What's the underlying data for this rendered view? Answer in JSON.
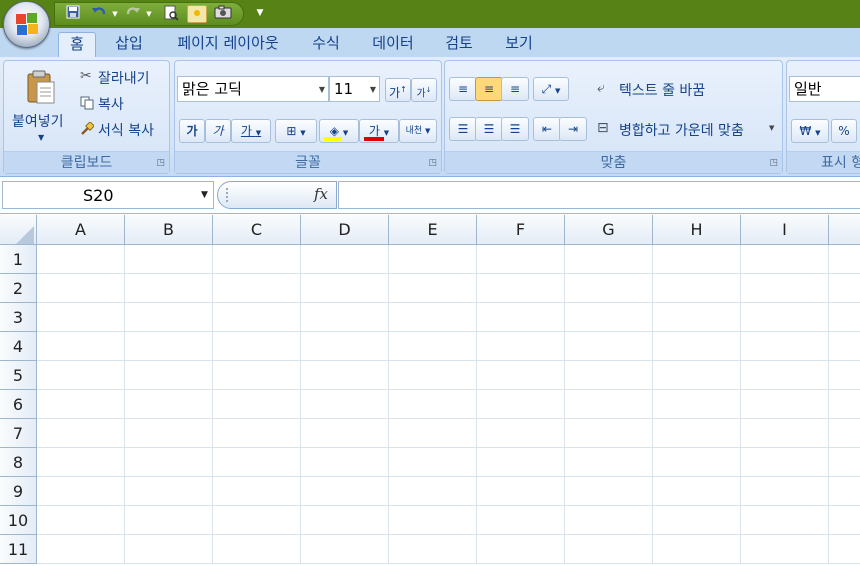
{
  "tabs": [
    "홈",
    "삽입",
    "페이지 레이아웃",
    "수식",
    "데이터",
    "검토",
    "보기"
  ],
  "clipboard": {
    "paste_label": "붙여넣기",
    "cut_label": "잘라내기",
    "copy_label": "복사",
    "format_painter_label": "서식 복사",
    "group_label": "클립보드"
  },
  "font": {
    "font_name": "맑은 고딕",
    "font_size": "11",
    "grow_label": "가",
    "shrink_label": "가",
    "bold_label": "가",
    "italic_label": "가",
    "underline_label": "가",
    "font_color_label": "가",
    "phonetic_label": "내천",
    "group_label": "글꼴",
    "fill_color": "#ffff00",
    "font_color": "#e00000"
  },
  "alignment": {
    "wrap_text_label": "텍스트 줄 바꿈",
    "merge_center_label": "병합하고 가운데 맞춤",
    "group_label": "맞춤"
  },
  "number": {
    "format": "일반",
    "currency_label": "₩",
    "percent_label": "%",
    "group_label": "표시 형"
  },
  "formula_bar": {
    "name_box": "S20",
    "fx_label": "fx",
    "formula": ""
  },
  "grid": {
    "columns": [
      "A",
      "B",
      "C",
      "D",
      "E",
      "F",
      "G",
      "H",
      "I"
    ],
    "rows": [
      "1",
      "2",
      "3",
      "4",
      "5",
      "6",
      "7",
      "8",
      "9",
      "10",
      "11"
    ]
  },
  "colors": {
    "title_bar": "#568216",
    "ribbon": "#d6e4f6",
    "accent_text": "#15428b"
  }
}
